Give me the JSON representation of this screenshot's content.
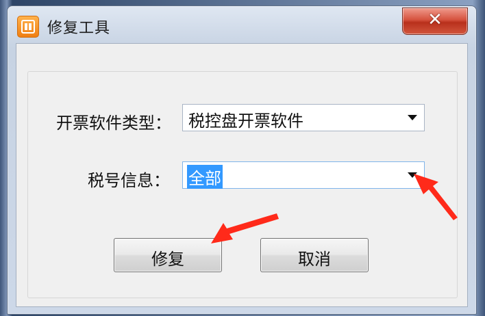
{
  "window": {
    "title": "修复工具",
    "close_label": "✕",
    "icon": "app-logo-icon"
  },
  "form": {
    "software_type_label": "开票软件类型：",
    "software_type_value": "税控盘开票软件",
    "tax_info_label": "税号信息：",
    "tax_info_value": "全部"
  },
  "buttons": {
    "repair_label": "修复",
    "cancel_label": "取消"
  },
  "annotations": {
    "arrow_color": "#ff2a1a"
  }
}
